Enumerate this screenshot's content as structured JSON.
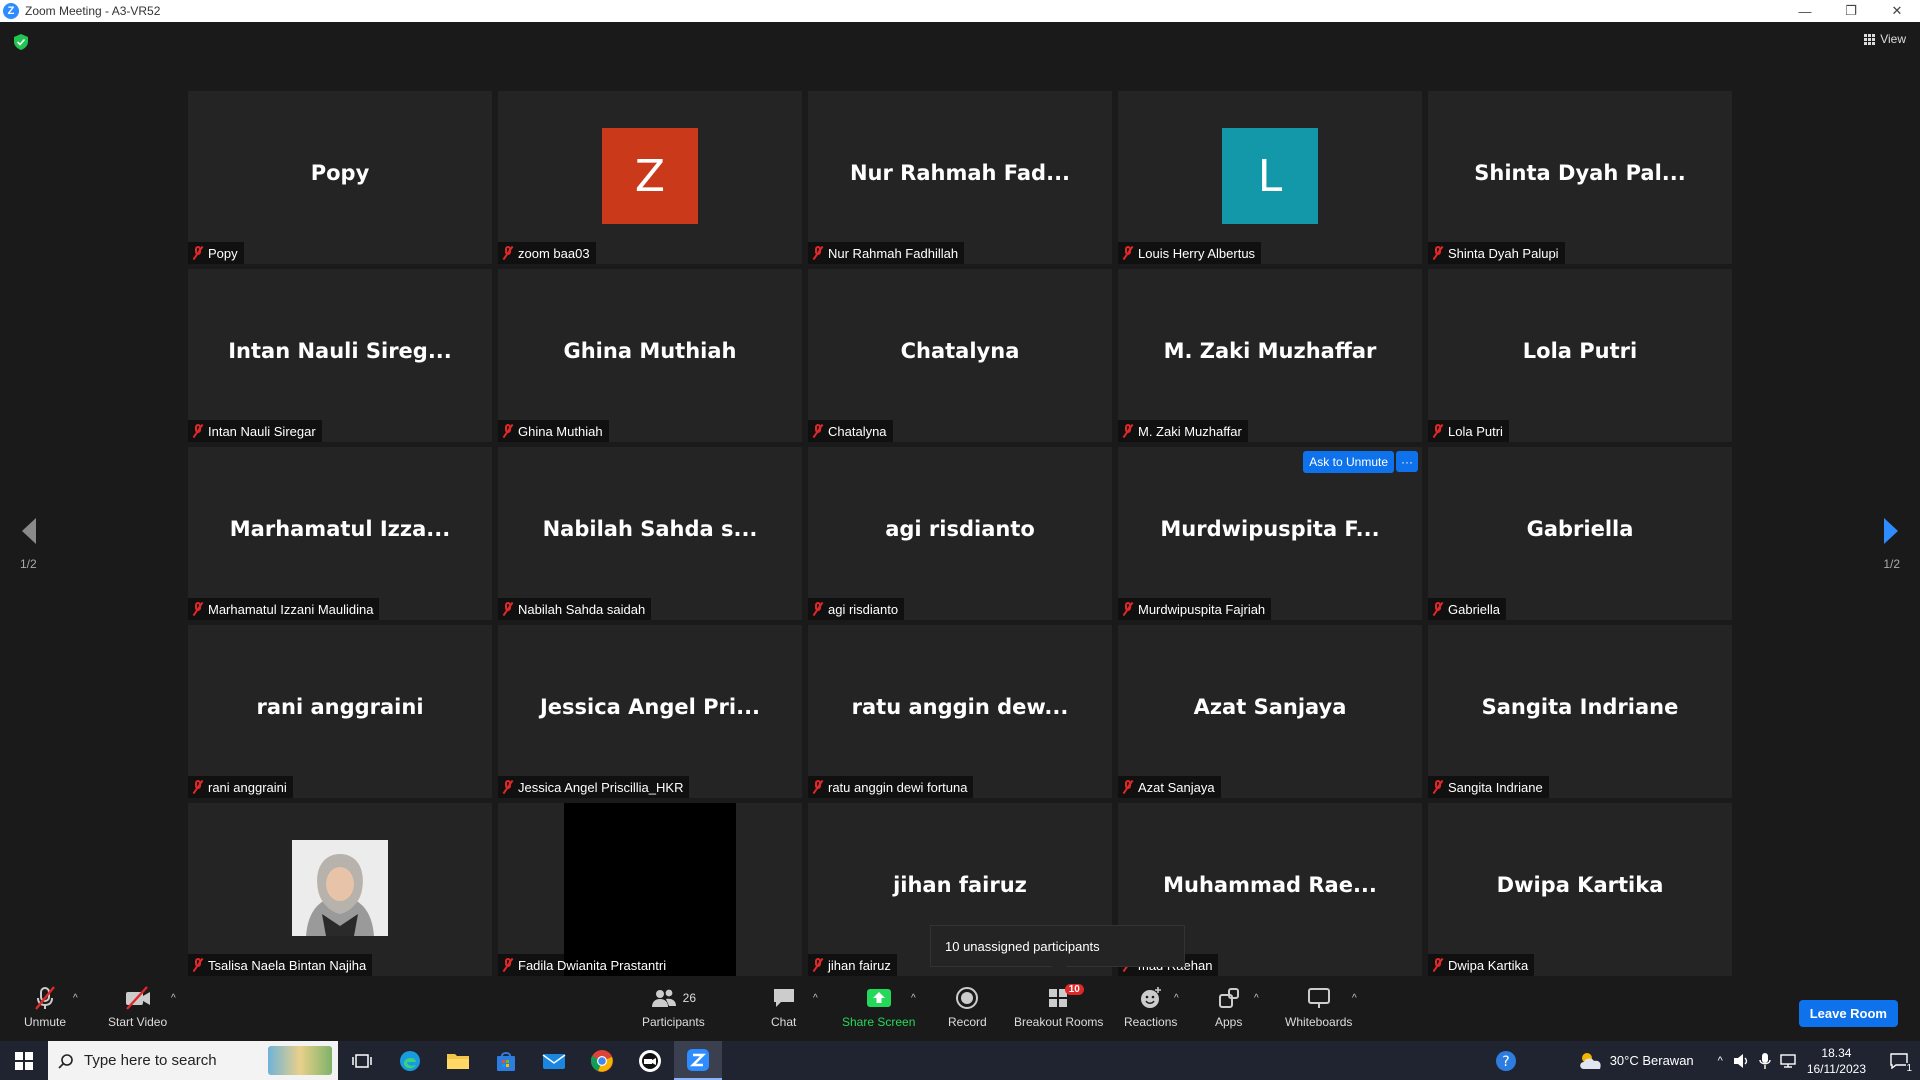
{
  "window": {
    "title": "Zoom Meeting - A3-VR52",
    "app_icon": "Z",
    "controls": [
      "—",
      "❐",
      "✕"
    ]
  },
  "topbar": {
    "view_label": "View"
  },
  "pager": {
    "left": "1/2",
    "right": "1/2"
  },
  "tiles": [
    {
      "display": "Popy",
      "label": "Popy"
    },
    {
      "display": "",
      "label": "zoom baa03",
      "avatar": "Z",
      "avatar_color": "#c9391a"
    },
    {
      "display": "Nur Rahmah Fad...",
      "label": "Nur Rahmah Fadhillah"
    },
    {
      "display": "",
      "label": "Louis Herry Albertus",
      "avatar": "L",
      "avatar_color": "#1298a8"
    },
    {
      "display": "Shinta Dyah Pal...",
      "label": "Shinta Dyah Palupi"
    },
    {
      "display": "Intan Nauli Sireg...",
      "label": "Intan Nauli Siregar"
    },
    {
      "display": "Ghina Muthiah",
      "label": "Ghina Muthiah"
    },
    {
      "display": "Chatalyna",
      "label": "Chatalyna"
    },
    {
      "display": "M. Zaki Muzhaffar",
      "label": "M. Zaki Muzhaffar"
    },
    {
      "display": "Lola Putri",
      "label": "Lola Putri"
    },
    {
      "display": "Marhamatul Izza...",
      "label": "Marhamatul Izzani Maulidina"
    },
    {
      "display": "Nabilah Sahda s...",
      "label": "Nabilah Sahda saidah"
    },
    {
      "display": "agi risdianto",
      "label": "agi risdianto"
    },
    {
      "display": "Murdwipuspita F...",
      "label": "Murdwipuspita Fajriah"
    },
    {
      "display": "Gabriella",
      "label": "Gabriella"
    },
    {
      "display": "rani anggraini",
      "label": "rani anggraini"
    },
    {
      "display": "Jessica Angel Pri...",
      "label": "Jessica Angel Priscillia_HKR"
    },
    {
      "display": "ratu anggin dew...",
      "label": "ratu anggin dewi fortuna"
    },
    {
      "display": "Azat Sanjaya",
      "label": "Azat Sanjaya"
    },
    {
      "display": "Sangita Indriane",
      "label": "Sangita Indriane"
    },
    {
      "display": "",
      "label": "Tsalisa Naela Bintan Najiha"
    },
    {
      "display": "",
      "label": "Fadila Dwianita Prastantri"
    },
    {
      "display": "jihan fairuz",
      "label": "jihan fairuz"
    },
    {
      "display": "Muhammad Rae...",
      "label": "mad Raehan"
    },
    {
      "display": "Dwipa Kartika",
      "label": "Dwipa Kartika"
    }
  ],
  "hover": {
    "ask_unmute": "Ask to Unmute",
    "more": "···"
  },
  "tooltip": "10 unassigned participants",
  "toolbar": {
    "unmute": "Unmute",
    "start_video": "Start Video",
    "participants": "Participants",
    "participants_count": "26",
    "chat": "Chat",
    "share_screen": "Share Screen",
    "record": "Record",
    "breakout_rooms": "Breakout Rooms",
    "breakout_badge": "10",
    "reactions": "Reactions",
    "apps": "Apps",
    "whiteboards": "Whiteboards",
    "leave": "Leave Room",
    "caret": "^"
  },
  "taskbar": {
    "search_placeholder": "Type here to search",
    "weather": "30°C  Berawan",
    "time": "18.34",
    "date": "16/11/2023",
    "notif_count": "1"
  },
  "colors": {
    "accent": "#0e72ed",
    "muted_red": "#e02828",
    "share_green": "#23d959"
  }
}
